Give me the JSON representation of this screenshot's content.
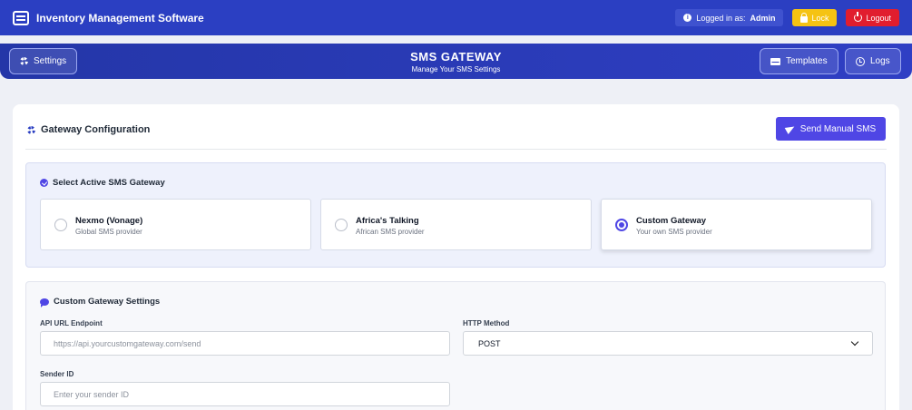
{
  "topbar": {
    "app_title": "Inventory Management Software",
    "logged_in_prefix": "Logged in as:",
    "logged_in_user": "Admin",
    "lock_label": "Lock",
    "logout_label": "Logout"
  },
  "header": {
    "settings_label": "Settings",
    "title": "SMS GATEWAY",
    "subtitle": "Manage Your SMS Settings",
    "templates_label": "Templates",
    "logs_label": "Logs"
  },
  "config": {
    "title": "Gateway Configuration",
    "send_button": "Send Manual SMS"
  },
  "gateway_select": {
    "title": "Select Active SMS Gateway",
    "options": [
      {
        "name": "Nexmo (Vonage)",
        "desc": "Global SMS provider",
        "selected": false
      },
      {
        "name": "Africa's Talking",
        "desc": "African SMS provider",
        "selected": false
      },
      {
        "name": "Custom Gateway",
        "desc": "Your own SMS provider",
        "selected": true
      }
    ]
  },
  "custom_settings": {
    "title": "Custom Gateway Settings",
    "api_label": "API URL Endpoint",
    "api_placeholder": "https://api.yourcustomgateway.com/send",
    "http_label": "HTTP Method",
    "http_value": "POST",
    "sender_label": "Sender ID",
    "sender_placeholder": "Enter your sender ID"
  },
  "colors": {
    "primary": "#2b3fc2",
    "accent": "#4f46e5",
    "lock": "#f5c313",
    "logout": "#e11d2e"
  }
}
